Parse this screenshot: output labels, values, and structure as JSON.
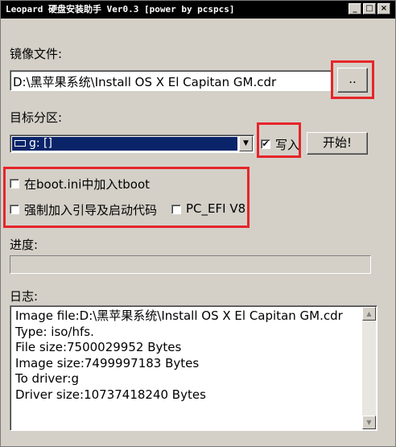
{
  "window": {
    "title": "Leopard 硬盘安装助手 Ver0.3 [power by pcspcs]"
  },
  "image_file": {
    "label": "镜像文件:",
    "value": "D:\\黑苹果系统\\Install OS X El Capitan GM.cdr",
    "browse_label": ".."
  },
  "target": {
    "label": "目标分区:",
    "selected": "g: []",
    "write_label": "写入",
    "write_checked": true,
    "start_label": "开始!"
  },
  "options": {
    "boot_ini_label": "在boot.ini中加入tboot",
    "boot_ini_checked": false,
    "force_boot_label": "强制加入引导及启动代码",
    "force_boot_checked": false,
    "pc_efi_label": "PC_EFI V8",
    "pc_efi_checked": false
  },
  "progress": {
    "label": "进度:",
    "value": 0
  },
  "log": {
    "label": "日志:",
    "lines": [
      "Image file:D:\\黑苹果系统\\Install OS X El Capitan GM.cdr",
      "Type: iso/hfs.",
      "File size:7500029952 Bytes",
      "Image size:7499997183 Bytes",
      "To driver:g",
      "Driver size:10737418240 Bytes"
    ]
  },
  "colors": {
    "highlight_box": "#e6252a",
    "selection": "#0a246a",
    "face": "#d4d0c8"
  }
}
